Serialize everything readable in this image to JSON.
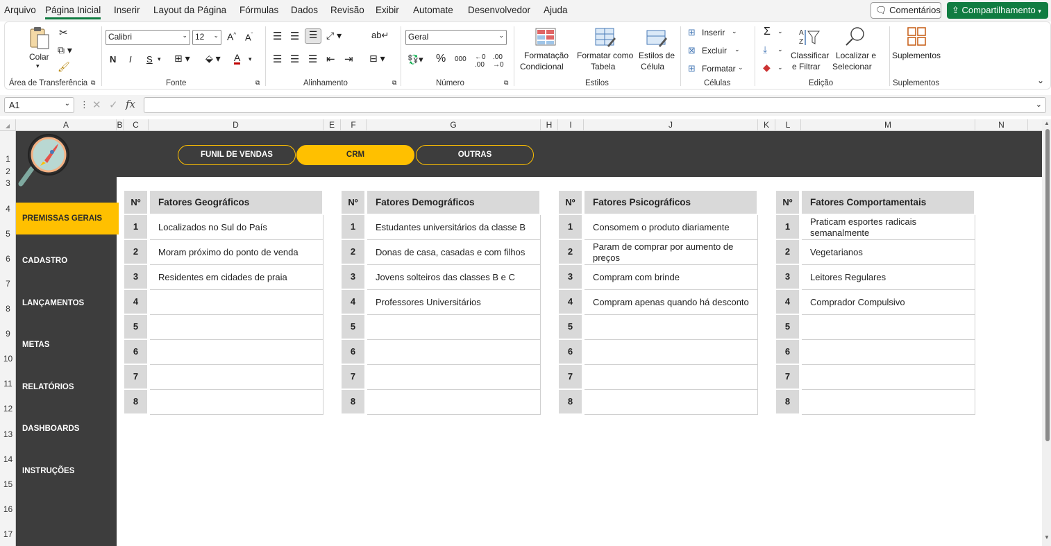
{
  "menu": {
    "items": [
      "Arquivo",
      "Página Inicial",
      "Inserir",
      "Layout da Página",
      "Fórmulas",
      "Dados",
      "Revisão",
      "Exibir",
      "Automate",
      "Desenvolvedor",
      "Ajuda"
    ],
    "comments_label": "Comentários",
    "share_label": "Compartilhamento"
  },
  "ribbon": {
    "clipboard": {
      "paste_label": "Colar",
      "group_label": "Área de Transferência"
    },
    "font": {
      "name": "Calibri",
      "size": "12",
      "bold": "N",
      "italic": "I",
      "underline": "S",
      "group_label": "Fonte"
    },
    "alignment": {
      "group_label": "Alinhamento"
    },
    "number": {
      "format": "Geral",
      "group_label": "Número"
    },
    "styles": {
      "conditional_1": "Formatação",
      "conditional_2": "Condicional",
      "table_1": "Formatar como",
      "table_2": "Tabela",
      "cell_1": "Estilos de",
      "cell_2": "Célula",
      "group_label": "Estilos"
    },
    "cells": {
      "insert": "Inserir",
      "delete": "Excluir",
      "format": "Formatar",
      "group_label": "Células"
    },
    "editing": {
      "sort_1": "Classificar",
      "sort_2": "e Filtrar",
      "find_1": "Localizar e",
      "find_2": "Selecionar",
      "group_label": "Edição"
    },
    "addins": {
      "label": "Suplementos",
      "group_label": "Suplementos"
    }
  },
  "formula_bar": {
    "name_box": "A1",
    "value": ""
  },
  "columns": [
    "A",
    "B",
    "C",
    "D",
    "E",
    "F",
    "G",
    "H",
    "I",
    "J",
    "K",
    "L",
    "M",
    "N"
  ],
  "rows": [
    "1",
    "2",
    "3",
    "4",
    "5",
    "6",
    "7",
    "8",
    "9",
    "10",
    "11",
    "12",
    "13",
    "14",
    "15",
    "16",
    "17"
  ],
  "top_nav": [
    "FUNIL DE VENDAS",
    "CRM",
    "OUTRAS"
  ],
  "sidebar": [
    "PREMISSAS GERAIS",
    "CADASTRO",
    "LANÇAMENTOS",
    "METAS",
    "RELATÓRIOS",
    "DASHBOARDS",
    "INSTRUÇÕES"
  ],
  "tables": [
    {
      "num_header": "Nº",
      "title": "Fatores Geográficos",
      "rows": [
        {
          "n": "1",
          "t": "Localizados no Sul do País"
        },
        {
          "n": "2",
          "t": "Moram próximo do ponto de venda"
        },
        {
          "n": "3",
          "t": "Residentes em cidades de praia"
        },
        {
          "n": "4",
          "t": ""
        },
        {
          "n": "5",
          "t": ""
        },
        {
          "n": "6",
          "t": ""
        },
        {
          "n": "7",
          "t": ""
        },
        {
          "n": "8",
          "t": ""
        }
      ]
    },
    {
      "num_header": "Nº",
      "title": "Fatores Demográficos",
      "rows": [
        {
          "n": "1",
          "t": "Estudantes universitários da classe B"
        },
        {
          "n": "2",
          "t": "Donas de casa, casadas e com filhos"
        },
        {
          "n": "3",
          "t": "Jovens solteiros das classes B e C"
        },
        {
          "n": "4",
          "t": "Professores Universitários"
        },
        {
          "n": "5",
          "t": ""
        },
        {
          "n": "6",
          "t": ""
        },
        {
          "n": "7",
          "t": ""
        },
        {
          "n": "8",
          "t": ""
        }
      ]
    },
    {
      "num_header": "Nº",
      "title": "Fatores Psicográficos",
      "rows": [
        {
          "n": "1",
          "t": "Consomem o produto diariamente"
        },
        {
          "n": "2",
          "t": "Param de comprar por aumento de preços"
        },
        {
          "n": "3",
          "t": "Compram com brinde"
        },
        {
          "n": "4",
          "t": "Compram apenas quando há desconto"
        },
        {
          "n": "5",
          "t": ""
        },
        {
          "n": "6",
          "t": ""
        },
        {
          "n": "7",
          "t": ""
        },
        {
          "n": "8",
          "t": ""
        }
      ]
    },
    {
      "num_header": "Nº",
      "title": "Fatores Comportamentais",
      "rows": [
        {
          "n": "1",
          "t": "Praticam esportes radicais semanalmente"
        },
        {
          "n": "2",
          "t": "Vegetarianos"
        },
        {
          "n": "3",
          "t": "Leitores Regulares"
        },
        {
          "n": "4",
          "t": "Comprador Compulsivo"
        },
        {
          "n": "5",
          "t": ""
        },
        {
          "n": "6",
          "t": ""
        },
        {
          "n": "7",
          "t": ""
        },
        {
          "n": "8",
          "t": ""
        }
      ]
    }
  ],
  "colors": {
    "accent": "#ffc000",
    "dark": "#3d3d3d",
    "excel_green": "#107c41",
    "header_gray": "#d9d9d9"
  },
  "icons": [
    "paste-icon",
    "rocket-magnifier-logo",
    "sum-icon",
    "sort-filter-icon",
    "find-icon",
    "addins-icon"
  ]
}
